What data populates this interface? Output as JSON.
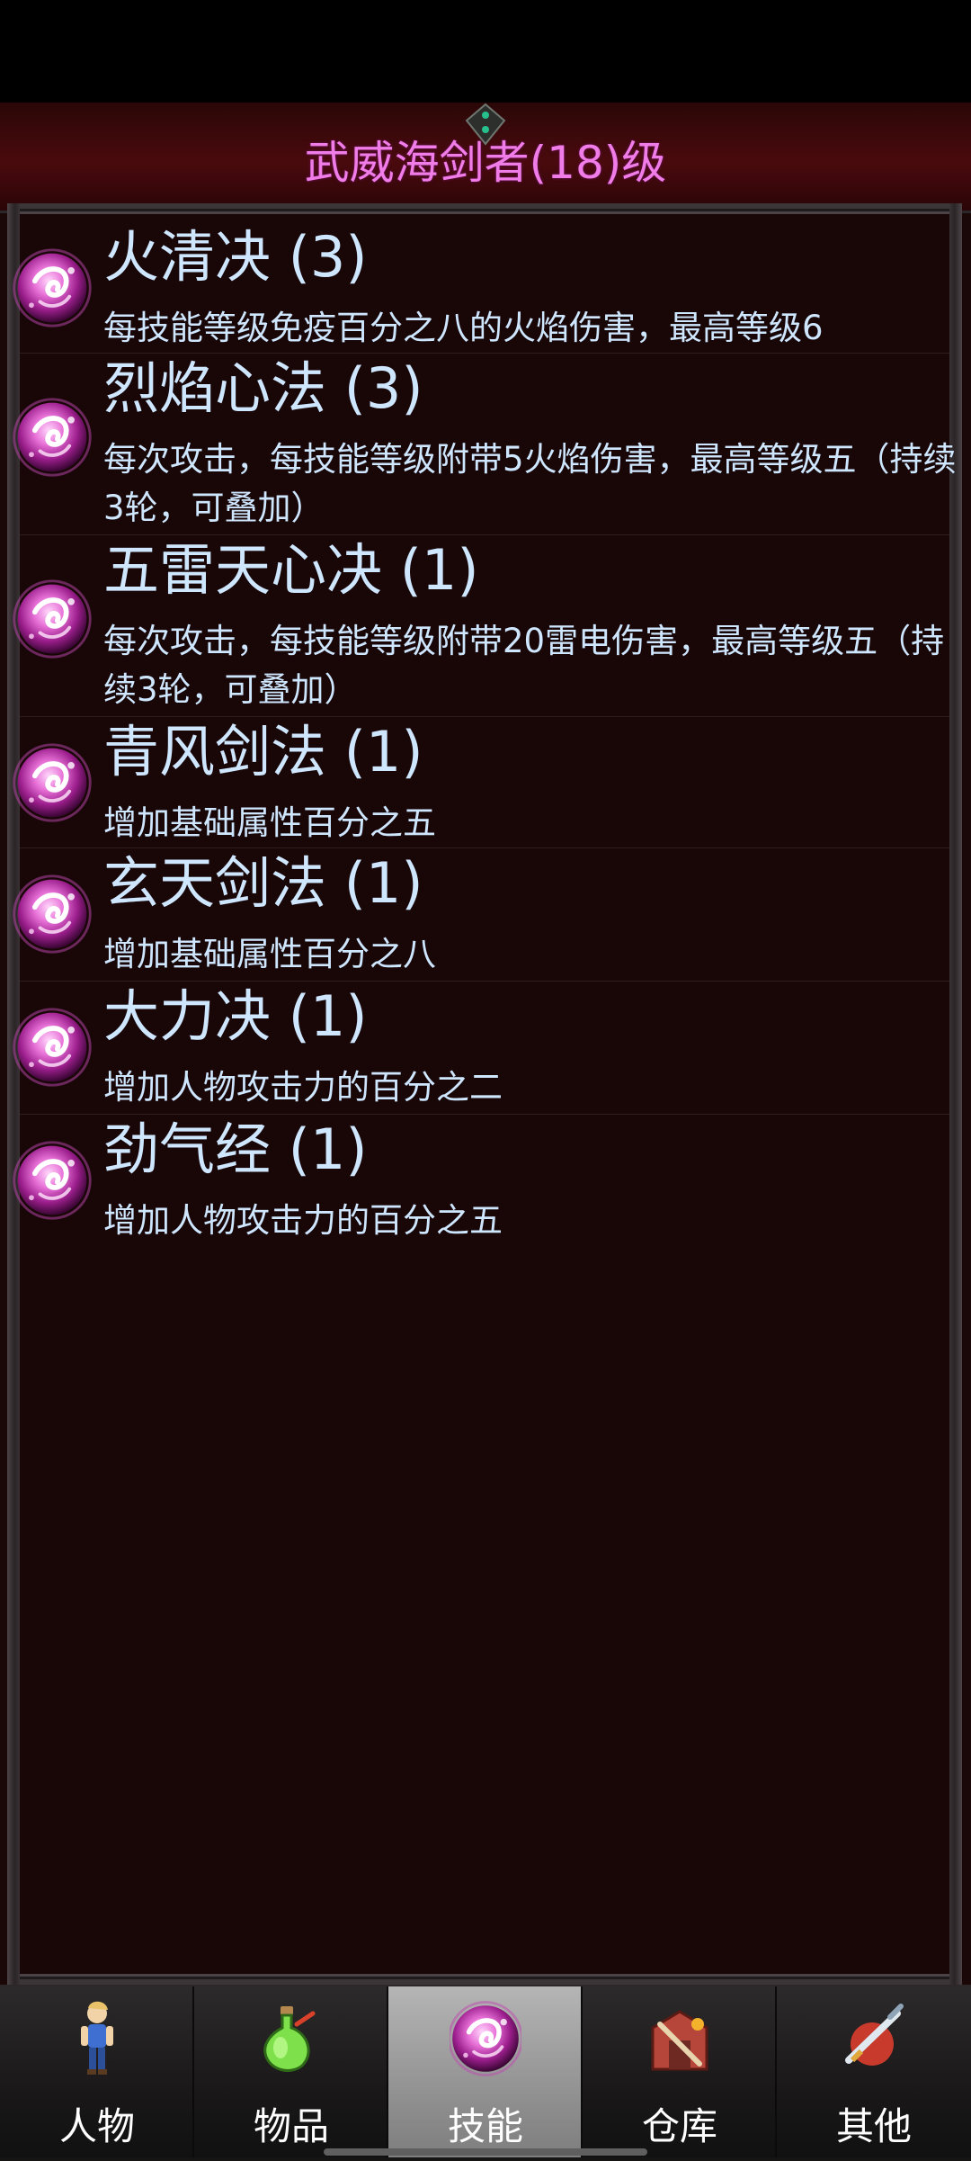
{
  "header": {
    "title": "武威海剑者(18)级"
  },
  "skills": [
    {
      "name": "火清决 (3)",
      "desc": "每技能等级免疫百分之八的火焰伤害，最高等级6",
      "icon": "pink-orb-skill-icon"
    },
    {
      "name": "烈焰心法 (3)",
      "desc": "每次攻击，每技能等级附带5火焰伤害，最高等级五（持续3轮，可叠加）",
      "icon": "pink-orb-skill-icon"
    },
    {
      "name": "五雷天心决 (1)",
      "desc": "每次攻击，每技能等级附带20雷电伤害，最高等级五（持续3轮，可叠加）",
      "icon": "pink-orb-skill-icon"
    },
    {
      "name": "青风剑法 (1)",
      "desc": "增加基础属性百分之五",
      "icon": "pink-orb-skill-icon"
    },
    {
      "name": "玄天剑法 (1)",
      "desc": "增加基础属性百分之八",
      "icon": "pink-orb-skill-icon"
    },
    {
      "name": "大力决 (1)",
      "desc": "增加人物攻击力的百分之二",
      "icon": "pink-orb-skill-icon"
    },
    {
      "name": "劲气经 (1)",
      "desc": "增加人物攻击力的百分之五",
      "icon": "pink-orb-skill-icon"
    }
  ],
  "tabs": [
    {
      "label": "人物",
      "icon": "character-icon",
      "active": false
    },
    {
      "label": "物品",
      "icon": "potion-icon",
      "active": false
    },
    {
      "label": "技能",
      "icon": "skill-orb-icon",
      "active": true
    },
    {
      "label": "仓库",
      "icon": "warehouse-icon",
      "active": false
    },
    {
      "label": "其他",
      "icon": "other-weapon-icon",
      "active": false
    }
  ],
  "colors": {
    "title": "#f07ce8",
    "skill_text": "#cfe6ff",
    "panel_bg": "#190708",
    "active_tab": "#a8a8a8"
  }
}
